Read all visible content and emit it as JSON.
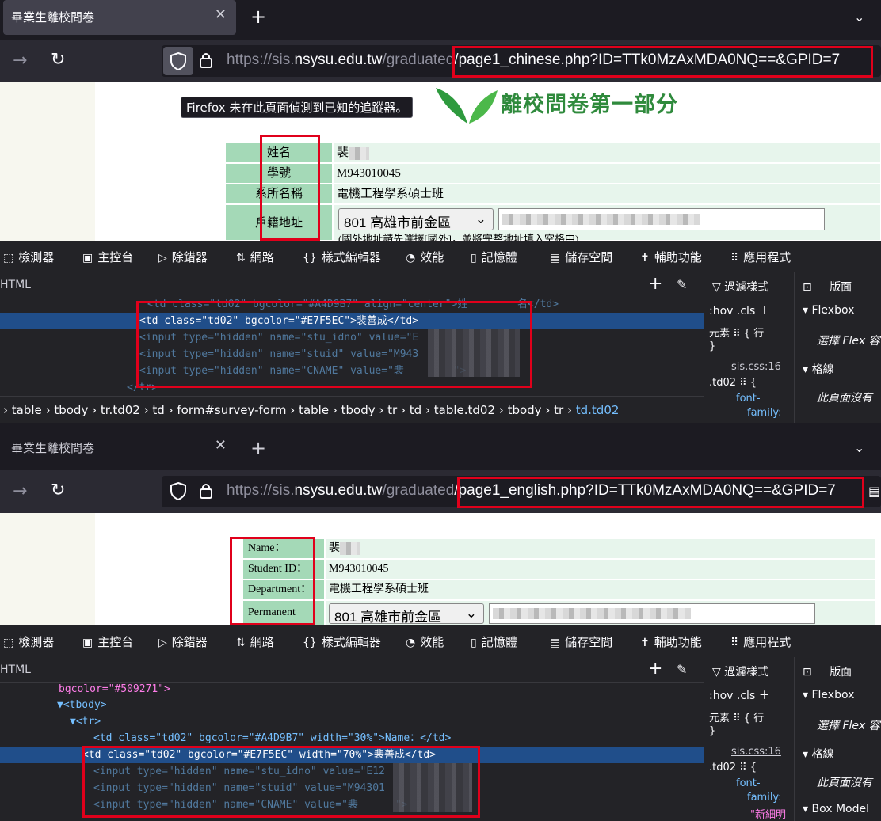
{
  "screen1": {
    "tab_title": "畢業生離校問卷",
    "url": {
      "prefix": "https://sis.",
      "host": "nsysu.edu.tw",
      "mid": "/graduated",
      "path": "/page1_chinese.php?ID=TTk0MzAxMDA0NQ==&GPID=7"
    },
    "tracker_tooltip": "Firefox 未在此頁面偵測到已知的追蹤器。",
    "banner": "離校問卷第一部分",
    "rows": [
      {
        "label": "姓名",
        "value": "裴"
      },
      {
        "label": "學號",
        "value": "M943010045"
      },
      {
        "label": "系所名稱",
        "value": "電機工程學系碩士班"
      },
      {
        "label": "戶籍地址",
        "value": ""
      }
    ],
    "address_select": "801 高雄市前金區",
    "address_hint": "(國外地址請先選擇[國外]，並將完整地址填入空格中)",
    "html_lines": [
      {
        "text": "<td class=\"td02\" bgcolor=\"#A4D9B7\" align=\"center\">姓        名</td>"
      },
      {
        "text": "<td class=\"td02\" bgcolor=\"#E7F5EC\">裴善成</td>"
      },
      {
        "text": "<input type=\"hidden\" name=\"stu_idno\" value=\"E"
      },
      {
        "text": "<input type=\"hidden\" name=\"stuid\" value=\"M943"
      },
      {
        "text": "<input type=\"hidden\" name=\"CNAME\" value=\"裴        \">"
      },
      {
        "text": "</tr>"
      }
    ],
    "breadcrumbs": [
      "table",
      "tbody",
      "tr.td02",
      "td",
      "form#survey-form",
      "table",
      "tbody",
      "tr",
      "td",
      "table.td02",
      "tbody",
      "tr",
      "td.td02"
    ]
  },
  "screen2": {
    "tab_title": "畢業生離校問卷",
    "url": {
      "prefix": "https://sis.",
      "host": "nsysu.edu.tw",
      "mid": "/graduated",
      "path": "/page1_english.php?ID=TTk0MzAxMDA0NQ==&GPID=7"
    },
    "rows": [
      {
        "label": "Name：",
        "value": "裴"
      },
      {
        "label": "Student ID：",
        "value": "M943010045"
      },
      {
        "label": "Department：",
        "value": "電機工程學系碩士班"
      },
      {
        "label": "Permanent",
        "value": ""
      }
    ],
    "address_select": "801 高雄市前金區",
    "html_lines": [
      {
        "text": "bgcolor=\"#509271\">"
      },
      {
        "text": "▼<tbody>"
      },
      {
        "text": "▼<tr>"
      },
      {
        "text": "<td class=\"td02\" bgcolor=\"#A4D9B7\" width=\"30%\">Name：</td>"
      },
      {
        "text": "<td class=\"td02\" bgcolor=\"#E7F5EC\" width=\"70%\">裴善成</td>"
      },
      {
        "text": "<input type=\"hidden\" name=\"stu_idno\" value=\"E12"
      },
      {
        "text": "<input type=\"hidden\" name=\"stuid\" value=\"M94301"
      },
      {
        "text": "<input type=\"hidden\" name=\"CNAME\" value=\"裴      \">"
      }
    ]
  },
  "devtools": {
    "tabs": [
      "檢測器",
      "主控台",
      "除錯器",
      "網路",
      "樣式編輯器",
      "效能",
      "記憶體",
      "儲存空間",
      "輔助功能",
      "應用程式"
    ],
    "html_label": "HTML",
    "filter_styles": "過濾樣式",
    "layout_tab": "版面",
    "hov": ":hov",
    "cls": ".cls",
    "flexbox": "Flexbox",
    "flex_hint": "選擇 Flex 容",
    "grid": "格線",
    "grid_hint": "此頁面沒有",
    "element_rule": "元素 ⠿ {   行",
    "close_brace": "}",
    "css_source": "sis.css:16",
    "td02_rule": ".td02 ⠿ {",
    "font_family": "font-",
    "font_family2": "family:",
    "font_value": "\"新細明",
    "box_model": "Box Model"
  }
}
